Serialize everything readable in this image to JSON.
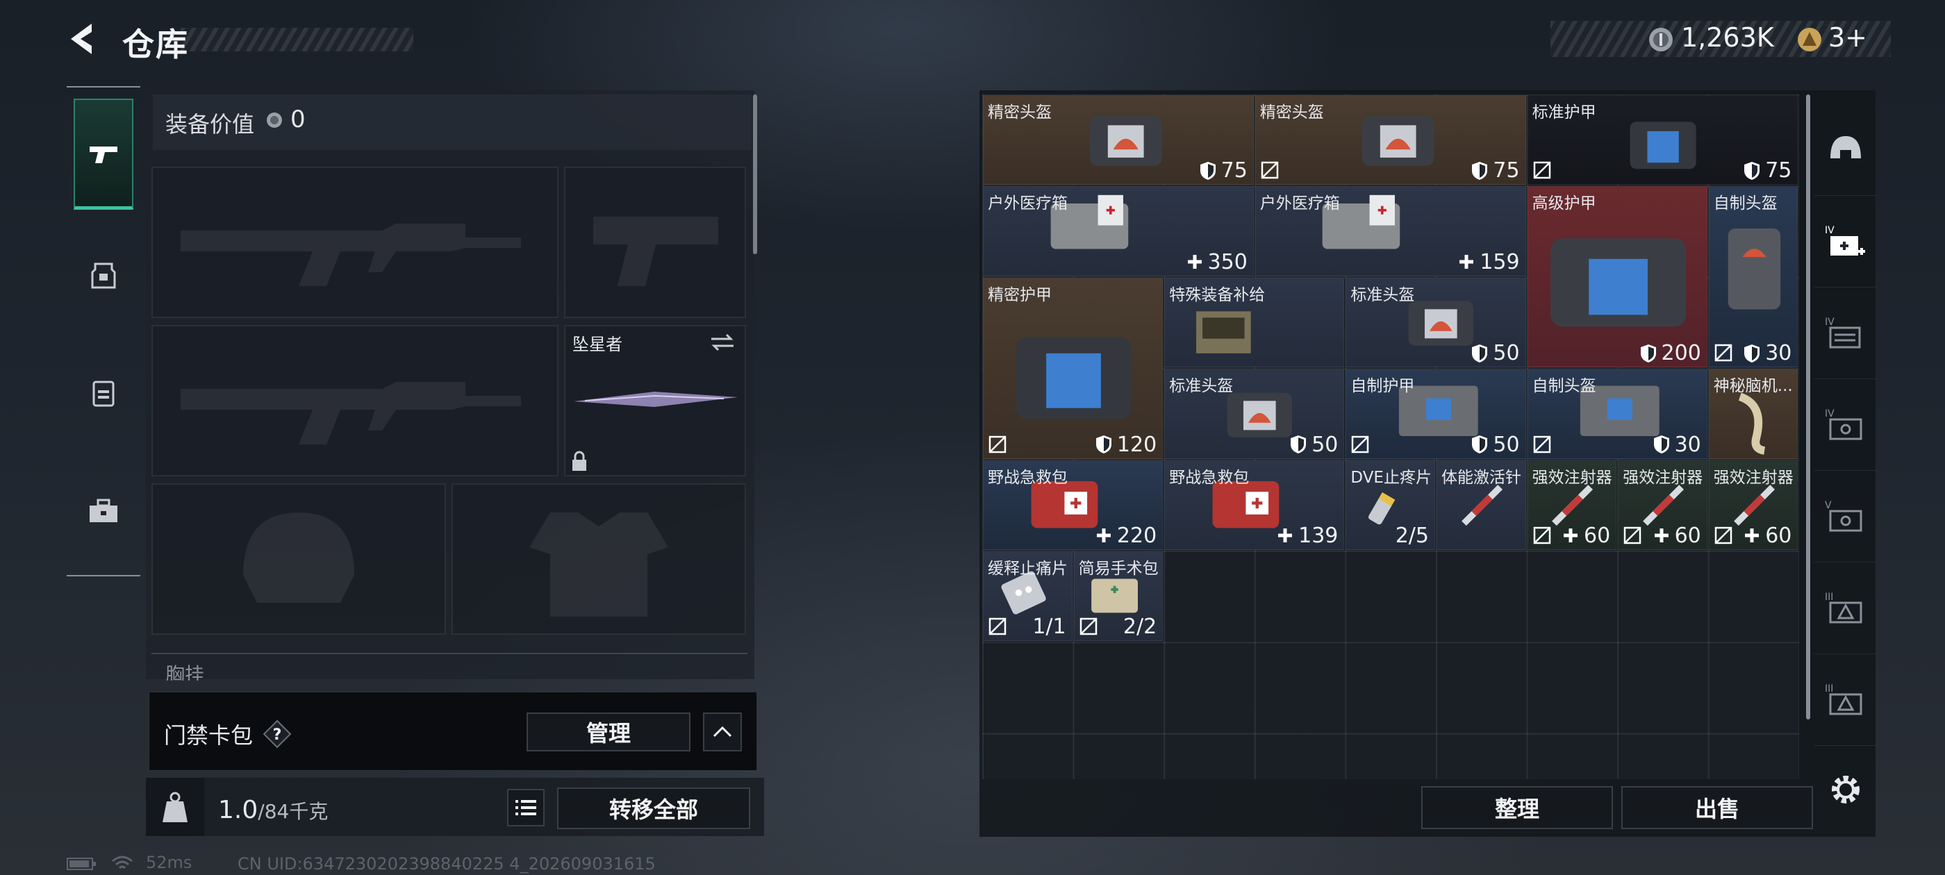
{
  "header": {
    "title": "仓库",
    "coin_value": "1,263K",
    "ticket_value": "3+"
  },
  "equipment": {
    "label": "装备价值",
    "value": "0",
    "melee_name": "坠星者",
    "chest_label": "胸挂",
    "keycard_label": "门禁卡包",
    "manage_label": "管理",
    "weight_current": "1.0",
    "weight_max": "/84千克",
    "transfer_label": "转移全部"
  },
  "status": {
    "ping": "52ms",
    "uid": "CN UID:6347230202398840225 4_202609031615"
  },
  "stash": {
    "items": [
      {
        "name": "精密头盔",
        "value": "75"
      },
      {
        "name": "精密头盔",
        "value": "75"
      },
      {
        "name": "标准护甲",
        "value": "75"
      },
      {
        "name": "户外医疗箱",
        "value": "350"
      },
      {
        "name": "户外医疗箱",
        "value": "159"
      },
      {
        "name": "高级护甲",
        "value": "200"
      },
      {
        "name": "自制头盔",
        "value": "30"
      },
      {
        "name": "精密护甲",
        "value": "120"
      },
      {
        "name": "特殊装备补给",
        "value": ""
      },
      {
        "name": "标准头盔",
        "value": "50"
      },
      {
        "name": "标准头盔",
        "value": "50"
      },
      {
        "name": "自制护甲",
        "value": "50"
      },
      {
        "name": "自制头盔",
        "value": "30"
      },
      {
        "name": "神秘脑机...",
        "value": ""
      },
      {
        "name": "野战急救包",
        "value": "220"
      },
      {
        "name": "野战急救包",
        "value": "139"
      },
      {
        "name": "DVE止疼片",
        "value": "2/5"
      },
      {
        "name": "体能激活针",
        "value": ""
      },
      {
        "name": "强效注射器",
        "value": "60"
      },
      {
        "name": "强效注射器",
        "value": "60"
      },
      {
        "name": "强效注射器",
        "value": "60"
      },
      {
        "name": "缓释止痛片",
        "value": "1/1"
      },
      {
        "name": "简易手术包",
        "value": "2/2"
      }
    ],
    "sort_label": "整理",
    "sell_label": "出售"
  }
}
